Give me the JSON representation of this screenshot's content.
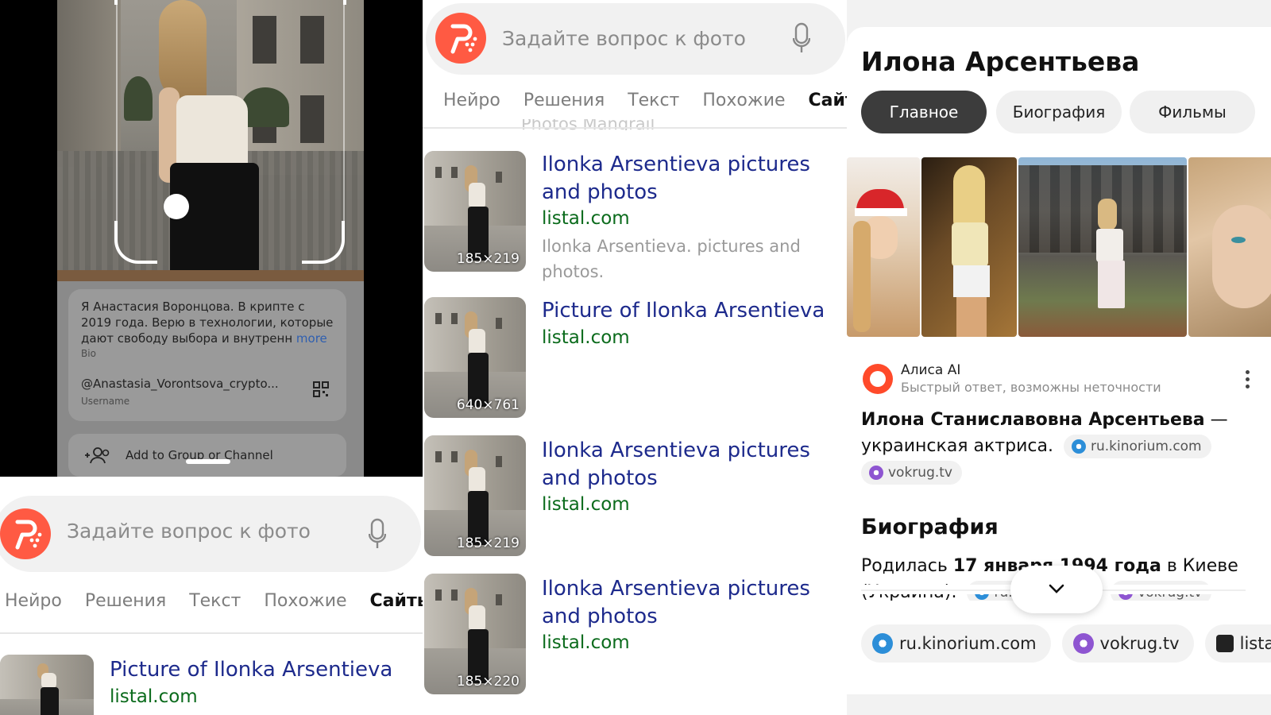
{
  "left_panel": {
    "bio": {
      "text": "Я Анастасия Воронцова. В крипте с 2019 года. Верю в технологии, которые дают свободу выбора и внутренн",
      "more": "more",
      "label": "Bio"
    },
    "username": {
      "value": "@Anastasia_Vorontsova_crypto...",
      "label": "Username"
    },
    "add_to_group": "Add to Group or Channel",
    "search_placeholder": "Задайте вопрос к фото",
    "tabs": [
      "Нейро",
      "Решения",
      "Текст",
      "Похожие",
      "Сайты"
    ],
    "active_tab": "Сайты",
    "result": {
      "title": "Picture of Ilonka Arsentieva",
      "host": "listal.com"
    }
  },
  "middle_panel": {
    "search_placeholder": "Задайте вопрос к фото",
    "tabs": [
      "Нейро",
      "Решения",
      "Текст",
      "Похожие",
      "Сайты"
    ],
    "active_tab": "Сайты",
    "ghost_text": "Photos Mangrail",
    "results": [
      {
        "title": "Ilonka Arsentieva pictures and photos",
        "host": "listal.com",
        "desc": "Ilonka Arsentieva. pictures and photos.",
        "size": "185×219"
      },
      {
        "title": "Picture of Ilonka Arsentieva",
        "host": "listal.com",
        "desc": "",
        "size": "640×761"
      },
      {
        "title": "Ilonka Arsentieva pictures and photos",
        "host": "listal.com",
        "desc": "",
        "size": "185×219"
      },
      {
        "title": "Ilonka Arsentieva pictures and photos",
        "host": "listal.com",
        "desc": "",
        "size": "185×220"
      }
    ]
  },
  "right_panel": {
    "title": "Илона Арсентьева",
    "chips": [
      "Главное",
      "Биография",
      "Фильмы"
    ],
    "active_chip": "Главное",
    "alice": {
      "name": "Алиса AI",
      "subtitle": "Быстрый ответ, возможны неточности"
    },
    "answer_bold": "Илона Станиславовна Арсентьева",
    "answer_rest": " — украинская актриса.",
    "answer_sources": [
      "ru.kinorium.com",
      "vokrug.tv"
    ],
    "bio_heading": "Биография",
    "bio_pre": "Родилась ",
    "bio_bold": "17 января 1994 года",
    "bio_post": " в Киеве (Украина).",
    "bio_sources": [
      "ru.ki",
      "vokrug.tv"
    ],
    "bottom_sources": [
      "ru.kinorium.com",
      "vokrug.tv",
      "listal.co"
    ]
  },
  "colors": {
    "yandex_red": "#ff5a43",
    "link_blue": "#1d2a8c",
    "host_green": "#0b6b1c"
  }
}
